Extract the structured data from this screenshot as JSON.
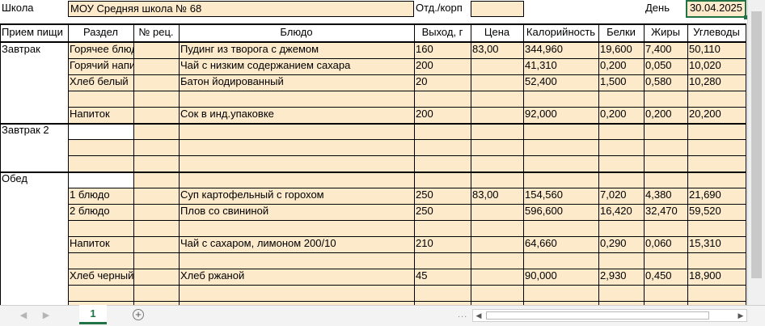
{
  "top": {
    "school_label": "Школа",
    "school_value": "МОУ Средняя школа № 68",
    "dept_label": "Отд./корп",
    "dept_value": "",
    "day_label": "День",
    "day_value": "30.04.2025"
  },
  "headers": [
    "Прием пищи",
    "Раздел",
    "№ рец.",
    "Блюдо",
    "Выход, г",
    "Цена",
    "Калорийность",
    "Белки",
    "Жиры",
    "Углеводы"
  ],
  "meals": {
    "breakfast": "Завтрак",
    "breakfast2": "Завтрак 2",
    "lunch": "Обед"
  },
  "rows": [
    {
      "section": "Горячее блюдо",
      "recipe": "",
      "dish": "Пудинг из творога с джемом",
      "output": "160",
      "price": "83,00",
      "kcal": "344,960",
      "protein": "19,600",
      "fat": "7,400",
      "carbs": "50,110"
    },
    {
      "section": "Горячий напиток",
      "recipe": "",
      "dish": "Чай с низким содержанием сахара",
      "output": "200",
      "price": "",
      "kcal": "41,310",
      "protein": "0,200",
      "fat": "0,050",
      "carbs": "10,020"
    },
    {
      "section": "Хлеб белый",
      "recipe": "",
      "dish": "Батон йодированный",
      "output": "20",
      "price": "",
      "kcal": "52,400",
      "protein": "1,500",
      "fat": "0,580",
      "carbs": "10,280"
    },
    {
      "section": "",
      "recipe": "",
      "dish": "",
      "output": "",
      "price": "",
      "kcal": "",
      "protein": "",
      "fat": "",
      "carbs": ""
    },
    {
      "section": "Напиток",
      "recipe": "",
      "dish": "Сок в инд.упаковке",
      "output": "200",
      "price": "",
      "kcal": "92,000",
      "protein": "0,200",
      "fat": "0,200",
      "carbs": "20,200"
    },
    {
      "section": "",
      "recipe": "",
      "dish": "",
      "output": "",
      "price": "",
      "kcal": "",
      "protein": "",
      "fat": "",
      "carbs": ""
    },
    {
      "section": "",
      "recipe": "",
      "dish": "",
      "output": "",
      "price": "",
      "kcal": "",
      "protein": "",
      "fat": "",
      "carbs": ""
    },
    {
      "section": "",
      "recipe": "",
      "dish": "",
      "output": "",
      "price": "",
      "kcal": "",
      "protein": "",
      "fat": "",
      "carbs": ""
    },
    {
      "section": "",
      "recipe": "",
      "dish": "",
      "output": "",
      "price": "",
      "kcal": "",
      "protein": "",
      "fat": "",
      "carbs": ""
    },
    {
      "section": "1 блюдо",
      "recipe": "",
      "dish": "Суп картофельный с горохом",
      "output": "250",
      "price": "83,00",
      "kcal": "154,560",
      "protein": "7,020",
      "fat": "4,380",
      "carbs": "21,690"
    },
    {
      "section": "2 блюдо",
      "recipe": "",
      "dish": "Плов со свининой",
      "output": "250",
      "price": "",
      "kcal": "596,600",
      "protein": "16,420",
      "fat": "32,470",
      "carbs": "59,520"
    },
    {
      "section": "",
      "recipe": "",
      "dish": "",
      "output": "",
      "price": "",
      "kcal": "",
      "protein": "",
      "fat": "",
      "carbs": ""
    },
    {
      "section": "Напиток",
      "recipe": "",
      "dish": "Чай с сахаром, лимоном 200/10",
      "output": "210",
      "price": "",
      "kcal": "64,660",
      "protein": "0,290",
      "fat": "0,060",
      "carbs": "15,310"
    },
    {
      "section": "",
      "recipe": "",
      "dish": "",
      "output": "",
      "price": "",
      "kcal": "",
      "protein": "",
      "fat": "",
      "carbs": ""
    },
    {
      "section": "Хлеб черный",
      "recipe": "",
      "dish": "Хлеб ржаной",
      "output": "45",
      "price": "",
      "kcal": "90,000",
      "protein": "2,930",
      "fat": "0,450",
      "carbs": "18,900"
    },
    {
      "section": "",
      "recipe": "",
      "dish": "",
      "output": "",
      "price": "",
      "kcal": "",
      "protein": "",
      "fat": "",
      "carbs": ""
    },
    {
      "section": "",
      "recipe": "",
      "dish": "",
      "output": "",
      "price": "",
      "kcal": "",
      "protein": "",
      "fat": "",
      "carbs": ""
    }
  ],
  "tabs": {
    "sheet_name": "1",
    "add_sheet": "+",
    "nav_prev": "◀",
    "nav_next": "▶",
    "dots": "...",
    "scroll_left": "◀",
    "scroll_right": "▶"
  },
  "colors": {
    "cell_fill": "#fdeacb",
    "selection": "#217346"
  }
}
